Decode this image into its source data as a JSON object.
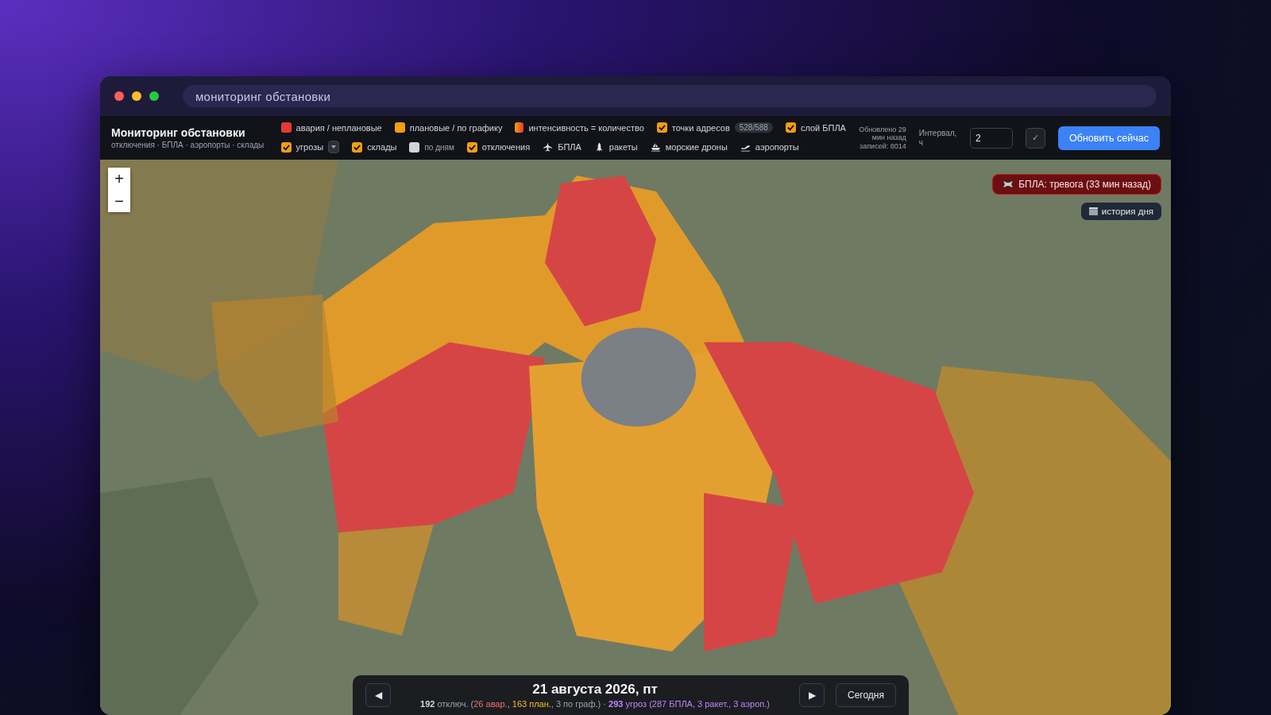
{
  "browser": {
    "address": "мониторинг обстановки"
  },
  "header": {
    "title": "Мониторинг обстановки",
    "subtitle": "отключения · БПЛА · аэропорты · склады"
  },
  "legend_row_1": [
    {
      "kind": "swatch",
      "label": "авария / неплановые",
      "color": "#e53935"
    },
    {
      "kind": "swatch",
      "label": "плановые / по графику",
      "color": "#f59e0b"
    },
    {
      "kind": "gradient",
      "label": "интенсивность = количество"
    },
    {
      "kind": "checkbox",
      "label": "точки адресов",
      "checked": true,
      "badge": "528/588"
    },
    {
      "kind": "checkbox",
      "label": "слой БПЛА",
      "checked": true
    }
  ],
  "legend_row_2": [
    {
      "kind": "checkbox",
      "label": "угрозы",
      "checked": true,
      "dropdown": true
    },
    {
      "kind": "checkbox",
      "label": "склады",
      "checked": true
    },
    {
      "kind": "checkbox",
      "label": "по дням",
      "checked": false,
      "muted": true
    },
    {
      "kind": "checkbox",
      "label": "отключения",
      "checked": true
    },
    {
      "kind": "plane",
      "label": "БПЛА"
    },
    {
      "kind": "rocket",
      "label": "ракеты"
    },
    {
      "kind": "boat",
      "label": "морские дроны"
    },
    {
      "kind": "departure",
      "label": "аэропорты"
    }
  ],
  "status": {
    "updated": "Обновлено 29 мин назад",
    "records": "записей: 8014"
  },
  "interval": {
    "label": "Интервал, ч",
    "value": "2",
    "confirm": "✓"
  },
  "refresh_button": "Обновить сейчас",
  "map": {
    "zoom_in": "+",
    "zoom_out": "−",
    "alert": "БПЛА: тревога (33 мин назад)",
    "history_button": "история дня"
  },
  "day_bar": {
    "prev": "◀",
    "next": "▶",
    "date": "21 августа 2026, пт",
    "today": "Сегодня",
    "summary": [
      {
        "kind": "bold",
        "text": "192"
      },
      {
        "kind": "plain",
        "text": " отключ. ("
      },
      {
        "kind": "red",
        "text": "26 авар."
      },
      {
        "kind": "plain",
        "text": ", "
      },
      {
        "kind": "orange",
        "text": "163 план."
      },
      {
        "kind": "plain",
        "text": ", 3 по граф.) · "
      },
      {
        "kind": "purple-bold",
        "text": "293"
      },
      {
        "kind": "purple",
        "text": " угроз (287 БПЛА, 3 ракет., 3 аэроп.)"
      }
    ]
  }
}
